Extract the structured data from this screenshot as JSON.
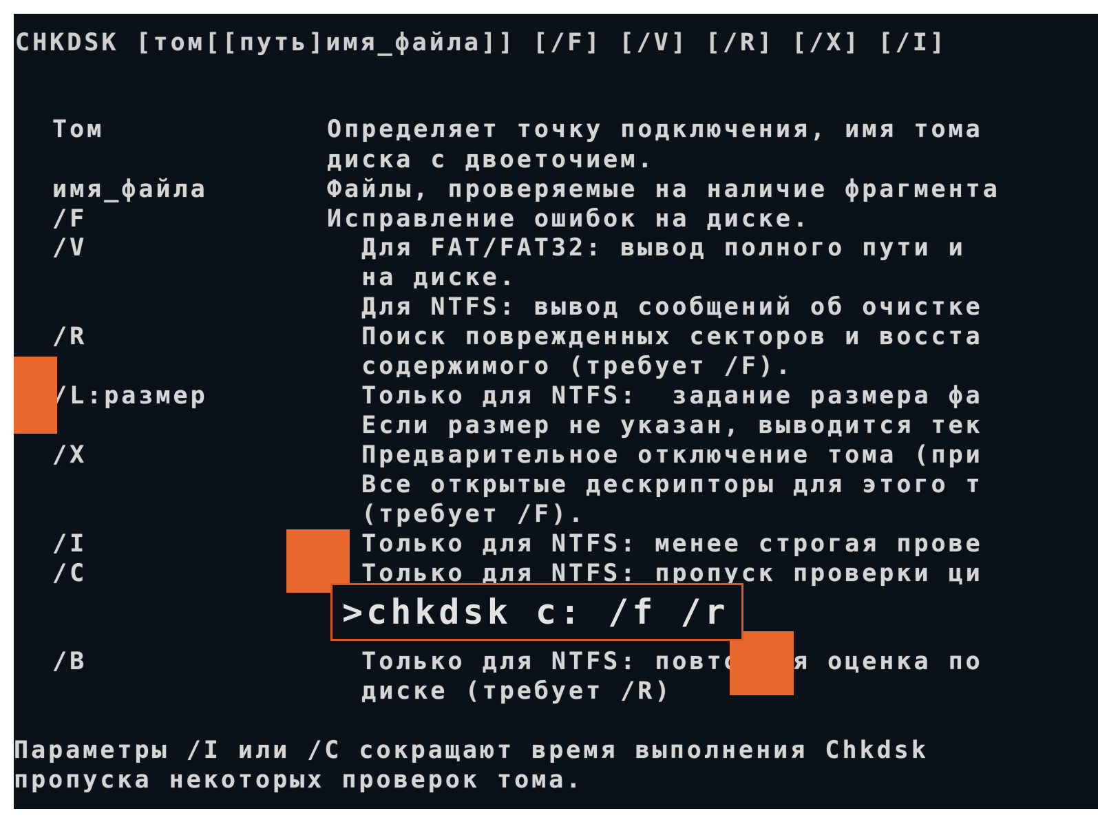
{
  "console": {
    "usage": "CHKDSK [том[[путь]имя_файла]] [/F] [/V] [/R] [/X] [/I]",
    "params": [
      {
        "name": "Том",
        "desc": "Определяет точку подключения, имя тома"
      },
      {
        "name": "",
        "desc": "диска с двоеточием."
      },
      {
        "name": "имя_файла",
        "desc": "Файлы, проверяемые на наличие фрагмента"
      },
      {
        "name": "/F",
        "desc": "Исправление ошибок на диске."
      },
      {
        "name": "/V",
        "desc": "  Для FAT/FAT32: вывод полного пути и"
      },
      {
        "name": "",
        "desc": "  на диске."
      },
      {
        "name": "",
        "desc": "  Для NTFS: вывод сообщений об очистке"
      },
      {
        "name": "/R",
        "desc": "  Поиск поврежденных секторов и восста"
      },
      {
        "name": "",
        "desc": "  содержимого (требует /F)."
      },
      {
        "name": "/L:размер",
        "desc": "  Только для NTFS:  задание размера фа"
      },
      {
        "name": "",
        "desc": "  Если размер не указан, выводится тек"
      },
      {
        "name": "/X",
        "desc": "  Предварительное отключение тома (при"
      },
      {
        "name": "",
        "desc": "  Все открытые дескрипторы для этого т"
      },
      {
        "name": "",
        "desc": "  (требует /F)."
      },
      {
        "name": "/I",
        "desc": "  Только для NTFS: менее строгая прове"
      },
      {
        "name": "/C",
        "desc": "  Только для NTFS: пропуск проверки ци"
      },
      {
        "name": "/B",
        "desc": "  Только для NTFS: повторная оценка по"
      },
      {
        "name": "",
        "desc": "  диске (требует /R)"
      }
    ],
    "footer": [
      "Параметры /I или /C сокращают время выполнения Chkdsk",
      "пропуска некоторых проверок тома."
    ]
  },
  "command": {
    "text": ">chkdsk c: /f /r"
  },
  "accent_color": "#e8682e",
  "background_color": "#0b1118"
}
